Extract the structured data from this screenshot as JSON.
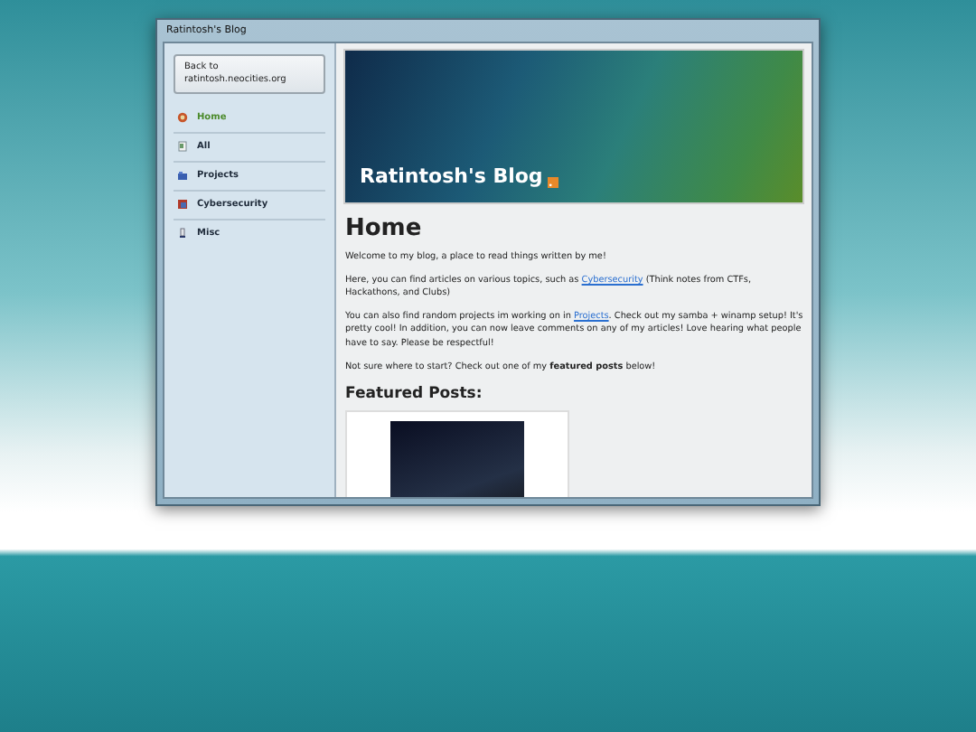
{
  "window": {
    "title": "Ratintosh's Blog"
  },
  "sidebar": {
    "back_button": "Back to ratintosh.neocities.org",
    "items": [
      {
        "label": "Home",
        "kind": "home",
        "selected": true
      },
      {
        "label": "All",
        "kind": "all",
        "selected": false
      },
      {
        "label": "Projects",
        "kind": "projects",
        "selected": false
      },
      {
        "label": "Cybersecurity",
        "kind": "security",
        "selected": false
      },
      {
        "label": "Misc",
        "kind": "misc",
        "selected": false
      }
    ]
  },
  "banner": {
    "title": "Ratintosh's Blog"
  },
  "page": {
    "heading": "Home",
    "paragraphs": [
      "Welcome to my blog, a place to read things written by me!",
      [
        {
          "kind": "text",
          "text": "Here, you can find articles on various topics, such as "
        },
        {
          "kind": "link",
          "text": "Cybersecurity"
        },
        {
          "kind": "text",
          "text": " (Think notes from CTFs, Hackathons, and Clubs)"
        }
      ],
      [
        {
          "kind": "text",
          "text": "You can also find random projects im working on in "
        },
        {
          "kind": "link",
          "text": "Projects"
        },
        {
          "kind": "text",
          "text": ". Check out my samba + winamp setup! It's pretty cool! In addition, you can now leave comments on any of my articles! Love hearing what people have to say. Please be respectful!"
        }
      ],
      "Not sure where to start? Check out one of my **featured posts** below!"
    ],
    "featured_heading": "Featured Posts:"
  }
}
